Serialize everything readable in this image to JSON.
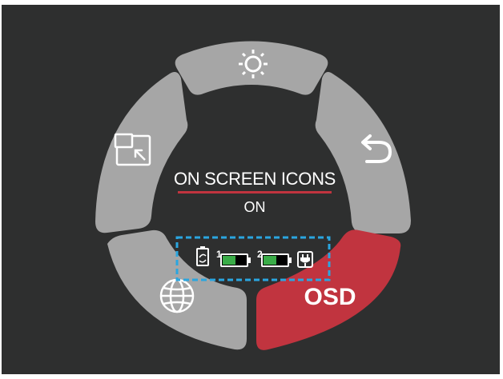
{
  "menu": {
    "center": {
      "title": "ON SCREEN ICONS",
      "value": "ON"
    },
    "segments": [
      {
        "id": "brightness",
        "icon": "sun-icon",
        "active": false
      },
      {
        "id": "back",
        "icon": "back-arrow-icon",
        "active": false
      },
      {
        "id": "osd",
        "icon": "",
        "label": "OSD",
        "active": true
      },
      {
        "id": "language",
        "icon": "globe-icon",
        "active": false
      },
      {
        "id": "pip",
        "icon": "picture-in-picture-icon",
        "active": false
      }
    ],
    "status_icons": {
      "battery_1_label": "1",
      "battery_2_label": "2"
    }
  },
  "colors": {
    "background": "#2e2f2f",
    "segment": "#a6a6a6",
    "active_segment": "#c1343f",
    "underline": "#c1343f",
    "highlight_box": "#2aa6e0",
    "battery_fill": "#3aac48"
  }
}
